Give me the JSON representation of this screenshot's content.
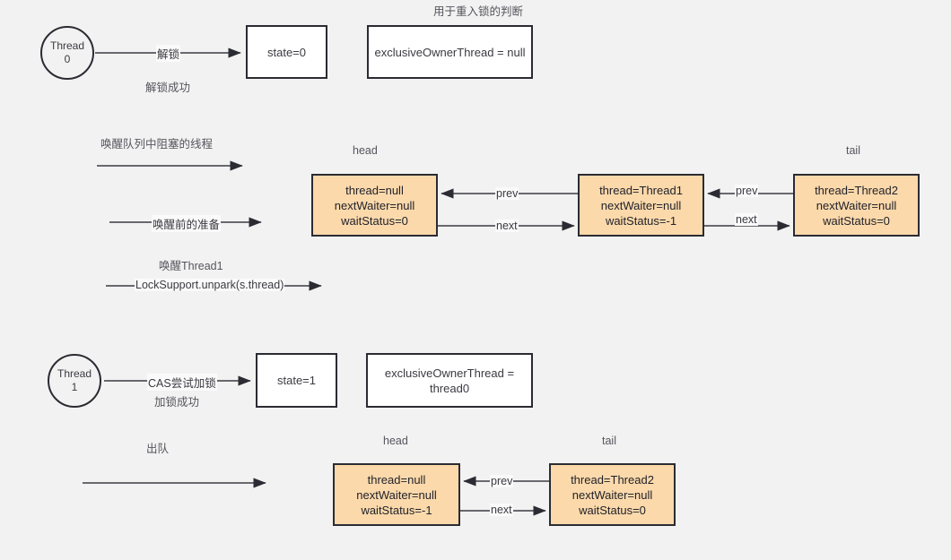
{
  "diagram": {
    "title_note": "用于重入锁的判断",
    "background": "#f2f2f2",
    "node_fill": "#fbd9ab",
    "stroke": "#2b2b33"
  },
  "section_unlock": {
    "thread_circle": {
      "line1": "Thread",
      "line2": "0"
    },
    "edge_label": "解锁",
    "edge_sub_label": "解锁成功",
    "state_box": "state=0",
    "owner_box": "exclusiveOwnerThread = null"
  },
  "section_wake": {
    "arrow1_caption": "唤醒队列中阻塞的线程",
    "arrow2_label": "唤醒前的准备",
    "arrow3_caption": "唤醒Thread1",
    "arrow3_label": "LockSupport.unpark(s.thread)",
    "head_label": "head",
    "tail_label": "tail",
    "nodes": [
      {
        "name": "head-node",
        "thread": "thread=null",
        "next_waiter": "nextWaiter=null",
        "wait_status": "waitStatus=0"
      },
      {
        "name": "thread1-node",
        "thread": "thread=Thread1",
        "next_waiter": "nextWaiter=null",
        "wait_status": "waitStatus=-1"
      },
      {
        "name": "thread2-node",
        "thread": "thread=Thread2",
        "next_waiter": "nextWaiter=null",
        "wait_status": "waitStatus=0"
      }
    ],
    "link_labels": {
      "prev1": "prev",
      "next1": "next",
      "prev2": "prev",
      "next2": "next"
    }
  },
  "section_lock": {
    "thread_circle": {
      "line1": "Thread",
      "line2": "1"
    },
    "edge_label": "CAS尝试加锁",
    "edge_sub_label": "加锁成功",
    "state_box": "state=1",
    "owner_box_line1": "exclusiveOwnerThread =",
    "owner_box_line2": "thread0"
  },
  "section_dequeue": {
    "caption": "出队",
    "head_label": "head",
    "tail_label": "tail",
    "nodes": [
      {
        "name": "head-node",
        "thread": "thread=null",
        "next_waiter": "nextWaiter=null",
        "wait_status": "waitStatus=-1"
      },
      {
        "name": "thread2-node",
        "thread": "thread=Thread2",
        "next_waiter": "nextWaiter=null",
        "wait_status": "waitStatus=0"
      }
    ],
    "link_labels": {
      "prev": "prev",
      "next": "next"
    }
  }
}
